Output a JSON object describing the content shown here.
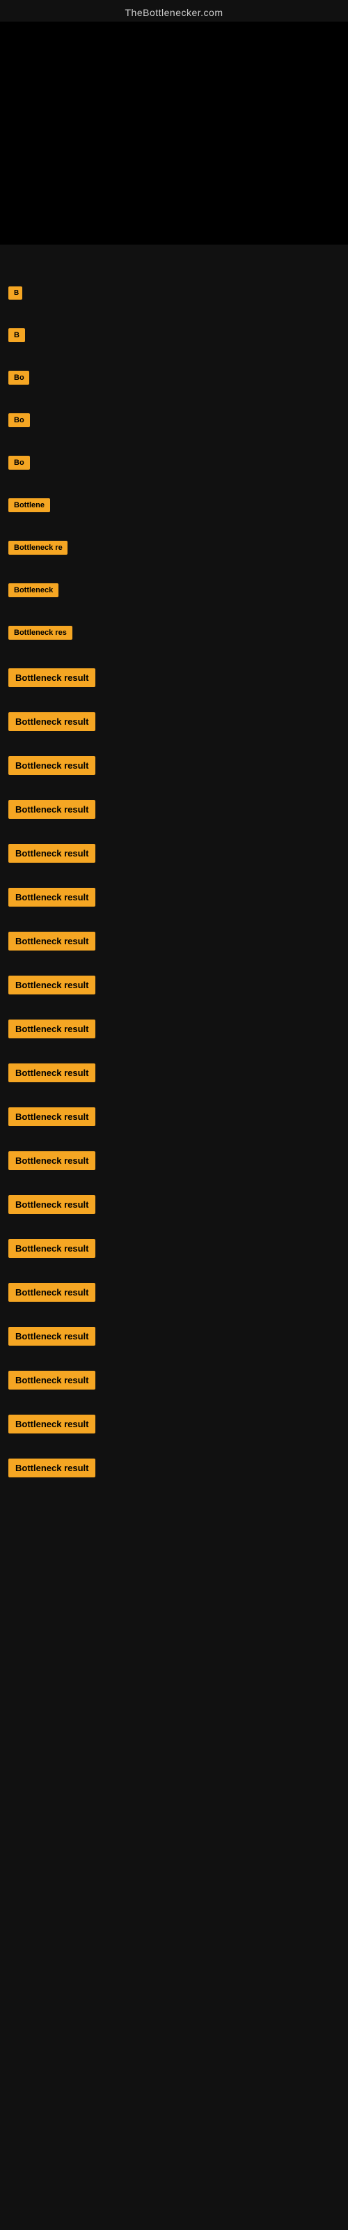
{
  "site": {
    "title": "TheBottlenecker.com"
  },
  "partialLabels": [
    {
      "text": "B",
      "size": "partial-1"
    },
    {
      "text": "B",
      "size": "partial-2"
    },
    {
      "text": "Bo",
      "size": "partial-3"
    },
    {
      "text": "Bo",
      "size": "partial-4"
    },
    {
      "text": "Bo",
      "size": "partial-5"
    },
    {
      "text": "Bottlene",
      "size": "partial-6"
    },
    {
      "text": "Bottleneck re",
      "size": "partial-7"
    },
    {
      "text": "Bottleneck",
      "size": "partial-8"
    },
    {
      "text": "Bottleneck res",
      "size": "partial-9"
    }
  ],
  "fullLabels": [
    "Bottleneck result",
    "Bottleneck result",
    "Bottleneck result",
    "Bottleneck result",
    "Bottleneck result",
    "Bottleneck result",
    "Bottleneck result",
    "Bottleneck result",
    "Bottleneck result",
    "Bottleneck result",
    "Bottleneck result",
    "Bottleneck result",
    "Bottleneck result",
    "Bottleneck result",
    "Bottleneck result",
    "Bottleneck result",
    "Bottleneck result",
    "Bottleneck result",
    "Bottleneck result"
  ]
}
